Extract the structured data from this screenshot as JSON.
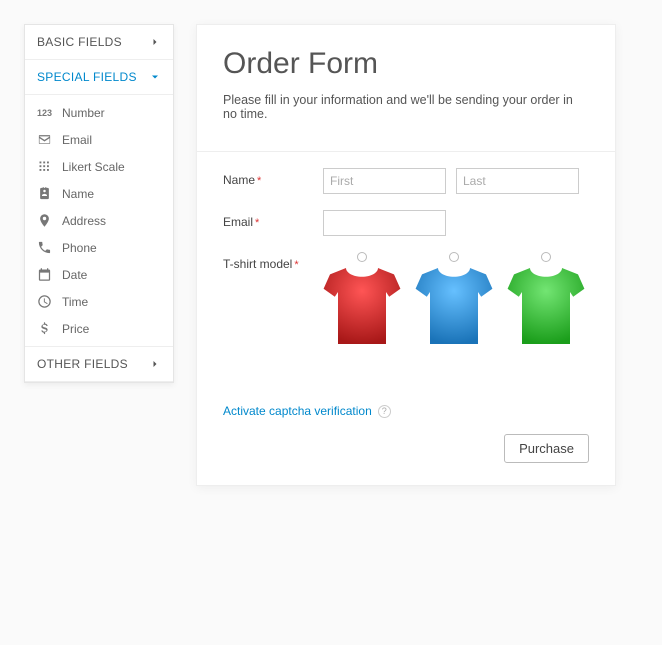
{
  "sidebar": {
    "sections": {
      "basic": {
        "label": "BASIC FIELDS"
      },
      "special": {
        "label": "SPECIAL FIELDS",
        "items": [
          {
            "label": "Number",
            "icon": "number-icon"
          },
          {
            "label": "Email",
            "icon": "email-icon"
          },
          {
            "label": "Likert Scale",
            "icon": "likert-icon"
          },
          {
            "label": "Name",
            "icon": "name-icon"
          },
          {
            "label": "Address",
            "icon": "address-icon"
          },
          {
            "label": "Phone",
            "icon": "phone-icon"
          },
          {
            "label": "Date",
            "icon": "date-icon"
          },
          {
            "label": "Time",
            "icon": "time-icon"
          },
          {
            "label": "Price",
            "icon": "price-icon"
          }
        ]
      },
      "other": {
        "label": "OTHER FIELDS"
      }
    }
  },
  "form": {
    "title": "Order Form",
    "subtitle": "Please fill in your information and we'll be sending your order in no time.",
    "name_label": "Name",
    "first_placeholder": "First",
    "last_placeholder": "Last",
    "email_label": "Email",
    "tshirt_label": "T-shirt model",
    "shirt_colors": [
      "#d82b2b",
      "#3399df",
      "#3bc63b"
    ],
    "captcha_label": "Activate captcha verification",
    "help_char": "?",
    "submit_label": "Purchase"
  }
}
